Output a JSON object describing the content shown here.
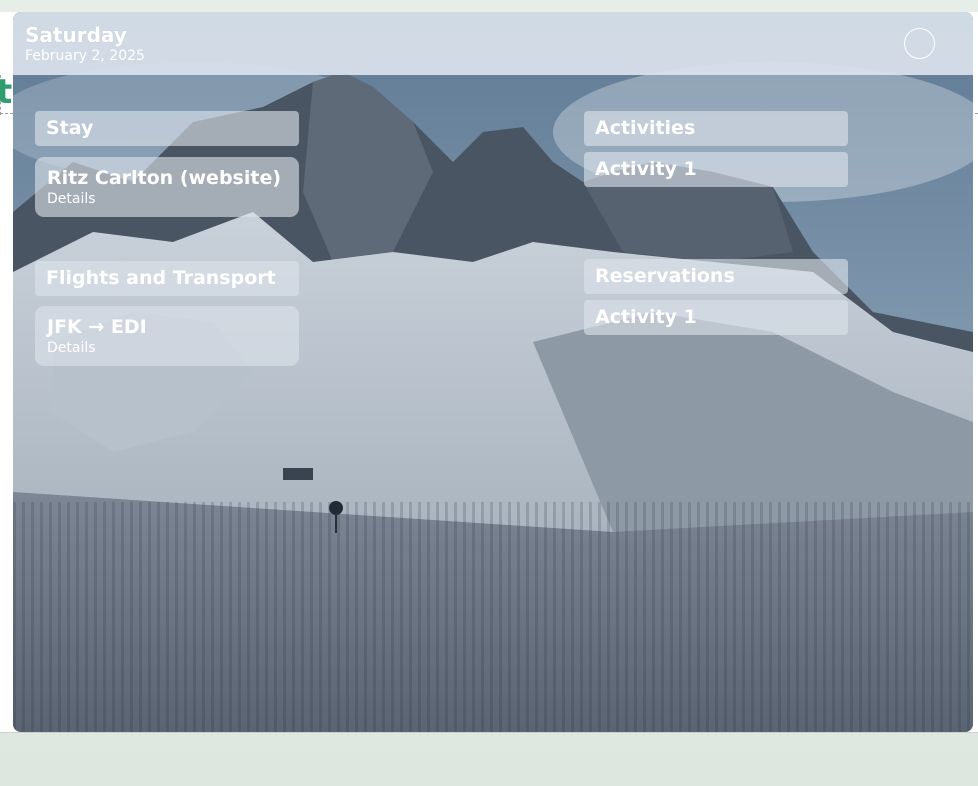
{
  "background_page": {
    "partial_letter": "t"
  },
  "header": {
    "day": "Saturday",
    "date": "February 2, 2025"
  },
  "stay": {
    "heading": "Stay",
    "item": {
      "title": "Ritz Carlton (website)",
      "subtitle": "Details"
    }
  },
  "flights": {
    "heading": "Flights and Transport",
    "item": {
      "title": "JFK → EDI",
      "subtitle": "Details"
    }
  },
  "activities": {
    "heading": "Activities",
    "items": [
      "Activity 1"
    ]
  },
  "reservations": {
    "heading": "Reservations",
    "items": [
      "Activity 1"
    ]
  },
  "colors": {
    "accent": "#2f9e6e",
    "overlay": "#dce2ea"
  }
}
